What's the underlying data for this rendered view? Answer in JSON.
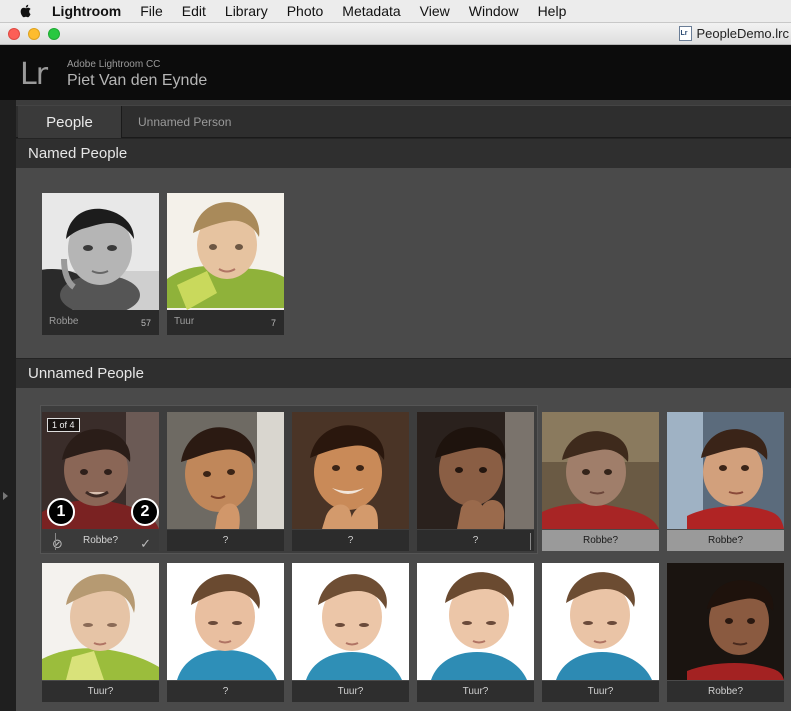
{
  "menubar": {
    "app": "Lightroom",
    "items": [
      "File",
      "Edit",
      "Library",
      "Photo",
      "Metadata",
      "View",
      "Window",
      "Help"
    ]
  },
  "window": {
    "document": "PeopleDemo.lrc"
  },
  "identity": {
    "app_name": "Adobe Lightroom CC",
    "catalog_owner": "Piet Van den Eynde",
    "logo": "Lr"
  },
  "toolbar": {
    "people_tab": "People",
    "breadcrumb": "Unnamed Person"
  },
  "named_section": {
    "title": "Named People",
    "people": [
      {
        "name": "Robbe",
        "count": "57"
      },
      {
        "name": "Tuur",
        "count": "7"
      }
    ]
  },
  "unnamed_section": {
    "title": "Unnamed People",
    "stack_badge": "1 of 4",
    "callouts": [
      "1",
      "2"
    ],
    "row1": [
      "Robbe?",
      "?",
      "?",
      "?",
      "Robbe?",
      "Robbe?"
    ],
    "row2": [
      "Tuur?",
      "?",
      "Tuur?",
      "Tuur?",
      "Tuur?",
      "Robbe?"
    ]
  },
  "icons": {
    "reject": "reject-icon",
    "confirm": "checkmark-icon"
  }
}
